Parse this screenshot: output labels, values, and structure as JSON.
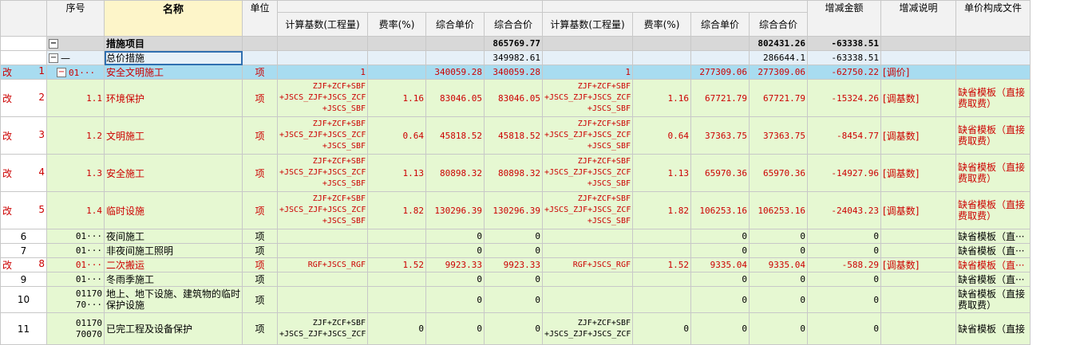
{
  "columns": {
    "seq": "序号",
    "name": "名称",
    "unit": "单位",
    "calc_base_1": "计算基数(工程量)",
    "rate_1": "费率(%)",
    "unit_price_1": "综合单价",
    "total_price_1": "综合合价",
    "calc_base_2": "计算基数(工程量)",
    "rate_2": "费率(%)",
    "unit_price_2": "综合单价",
    "total_price_2": "综合合价",
    "change_amount": "增减金额",
    "change_note": "增减说明",
    "template_file": "单价构成文件"
  },
  "rows": [
    {
      "rownum": "",
      "mark": "",
      "seq": "",
      "name": "措施项目",
      "unit": "",
      "base1": "",
      "rate1": "",
      "up1": "",
      "tp1": "865769.77",
      "base2": "",
      "rate2": "",
      "up2": "",
      "tp2": "802431.26",
      "delta": "-63338.51",
      "note": "",
      "tpl": ""
    },
    {
      "rownum": "",
      "mark": "",
      "seq": "—",
      "name": "总价措施",
      "unit": "",
      "base1": "",
      "rate1": "",
      "up1": "",
      "tp1": "349982.61",
      "base2": "",
      "rate2": "",
      "up2": "",
      "tp2": "286644.1",
      "delta": "-63338.51",
      "note": "",
      "tpl": ""
    },
    {
      "rownum": "1",
      "mark": "改",
      "seq": "01···",
      "name": "安全文明施工",
      "unit": "项",
      "base1": "1",
      "rate1": "",
      "up1": "340059.28",
      "tp1": "340059.28",
      "base2": "1",
      "rate2": "",
      "up2": "277309.06",
      "tp2": "277309.06",
      "delta": "-62750.22",
      "note": "[调价]",
      "tpl": ""
    },
    {
      "rownum": "2",
      "mark": "改",
      "seq": "1.1",
      "name": "环境保护",
      "unit": "项",
      "base1": "ZJF+ZCF+SBF +JSCS_ZJF+JSCS_ZCF +JSCS_SBF",
      "rate1": "1.16",
      "up1": "83046.05",
      "tp1": "83046.05",
      "base2": "ZJF+ZCF+SBF +JSCS_ZJF+JSCS_ZCF +JSCS_SBF",
      "rate2": "1.16",
      "up2": "67721.79",
      "tp2": "67721.79",
      "delta": "-15324.26",
      "note": "[调基数]",
      "tpl": "缺省模板（直接费取费）"
    },
    {
      "rownum": "3",
      "mark": "改",
      "seq": "1.2",
      "name": "文明施工",
      "unit": "项",
      "base1": "ZJF+ZCF+SBF +JSCS_ZJF+JSCS_ZCF +JSCS_SBF",
      "rate1": "0.64",
      "up1": "45818.52",
      "tp1": "45818.52",
      "base2": "ZJF+ZCF+SBF +JSCS_ZJF+JSCS_ZCF +JSCS_SBF",
      "rate2": "0.64",
      "up2": "37363.75",
      "tp2": "37363.75",
      "delta": "-8454.77",
      "note": "[调基数]",
      "tpl": "缺省模板（直接费取费）"
    },
    {
      "rownum": "4",
      "mark": "改",
      "seq": "1.3",
      "name": "安全施工",
      "unit": "项",
      "base1": "ZJF+ZCF+SBF +JSCS_ZJF+JSCS_ZCF +JSCS_SBF",
      "rate1": "1.13",
      "up1": "80898.32",
      "tp1": "80898.32",
      "base2": "ZJF+ZCF+SBF +JSCS_ZJF+JSCS_ZCF +JSCS_SBF",
      "rate2": "1.13",
      "up2": "65970.36",
      "tp2": "65970.36",
      "delta": "-14927.96",
      "note": "[调基数]",
      "tpl": "缺省模板（直接费取费）"
    },
    {
      "rownum": "5",
      "mark": "改",
      "seq": "1.4",
      "name": "临时设施",
      "unit": "项",
      "base1": "ZJF+ZCF+SBF +JSCS_ZJF+JSCS_ZCF +JSCS_SBF",
      "rate1": "1.82",
      "up1": "130296.39",
      "tp1": "130296.39",
      "base2": "ZJF+ZCF+SBF +JSCS_ZJF+JSCS_ZCF +JSCS_SBF",
      "rate2": "1.82",
      "up2": "106253.16",
      "tp2": "106253.16",
      "delta": "-24043.23",
      "note": "[调基数]",
      "tpl": "缺省模板（直接费取费）"
    },
    {
      "rownum": "6",
      "mark": "",
      "seq": "01···",
      "name": "夜间施工",
      "unit": "项",
      "base1": "",
      "rate1": "",
      "up1": "0",
      "tp1": "0",
      "base2": "",
      "rate2": "",
      "up2": "0",
      "tp2": "0",
      "delta": "0",
      "note": "",
      "tpl": "缺省模板（直···"
    },
    {
      "rownum": "7",
      "mark": "",
      "seq": "01···",
      "name": "非夜间施工照明",
      "unit": "项",
      "base1": "",
      "rate1": "",
      "up1": "0",
      "tp1": "0",
      "base2": "",
      "rate2": "",
      "up2": "0",
      "tp2": "0",
      "delta": "0",
      "note": "",
      "tpl": "缺省模板（直···"
    },
    {
      "rownum": "8",
      "mark": "改",
      "seq": "01···",
      "name": "二次搬运",
      "unit": "项",
      "base1": "RGF+JSCS_RGF",
      "rate1": "1.52",
      "up1": "9923.33",
      "tp1": "9923.33",
      "base2": "RGF+JSCS_RGF",
      "rate2": "1.52",
      "up2": "9335.04",
      "tp2": "9335.04",
      "delta": "-588.29",
      "note": "[调基数]",
      "tpl": "缺省模板（直···"
    },
    {
      "rownum": "9",
      "mark": "",
      "seq": "01···",
      "name": "冬雨季施工",
      "unit": "项",
      "base1": "",
      "rate1": "",
      "up1": "0",
      "tp1": "0",
      "base2": "",
      "rate2": "",
      "up2": "0",
      "tp2": "0",
      "delta": "0",
      "note": "",
      "tpl": "缺省模板（直···"
    },
    {
      "rownum": "10",
      "mark": "",
      "seq": "01170 70···",
      "name": "地上、地下设施、建筑物的临时保护设施",
      "unit": "项",
      "base1": "",
      "rate1": "",
      "up1": "0",
      "tp1": "0",
      "base2": "",
      "rate2": "",
      "up2": "0",
      "tp2": "0",
      "delta": "0",
      "note": "",
      "tpl": "缺省模板（直接费取费）"
    },
    {
      "rownum": "11",
      "mark": "",
      "seq": "01170 70070",
      "name": "已完工程及设备保护",
      "unit": "项",
      "base1": "ZJF+ZCF+SBF +JSCS_ZJF+JSCS_ZCF",
      "rate1": "0",
      "up1": "0",
      "tp1": "0",
      "base2": "ZJF+ZCF+SBF +JSCS_ZJF+JSCS_ZCF",
      "rate2": "0",
      "up2": "0",
      "tp2": "0",
      "delta": "0",
      "note": "",
      "tpl": "缺省模板（直接"
    }
  ]
}
